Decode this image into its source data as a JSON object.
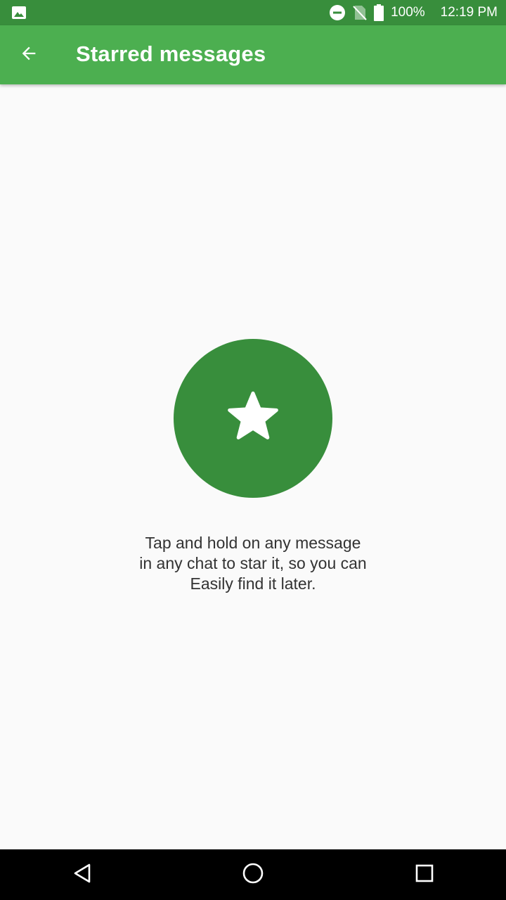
{
  "status_bar": {
    "battery": "100%",
    "time": "12:19 PM",
    "icons": [
      "image-notification-icon",
      "do-not-disturb-icon",
      "no-sim-icon",
      "battery-icon"
    ]
  },
  "app_bar": {
    "title": "Starred messages",
    "background": "#4caf50",
    "back_icon": "arrow-back-icon"
  },
  "empty_state": {
    "icon": "star-icon",
    "circle_color": "#388e3c",
    "lines": [
      "Tap and hold on any message",
      "in any chat to star it, so you can",
      "Easily find it later."
    ]
  },
  "nav_bar": {
    "buttons": [
      "back-triangle-icon",
      "home-circle-icon",
      "recents-square-icon"
    ]
  }
}
